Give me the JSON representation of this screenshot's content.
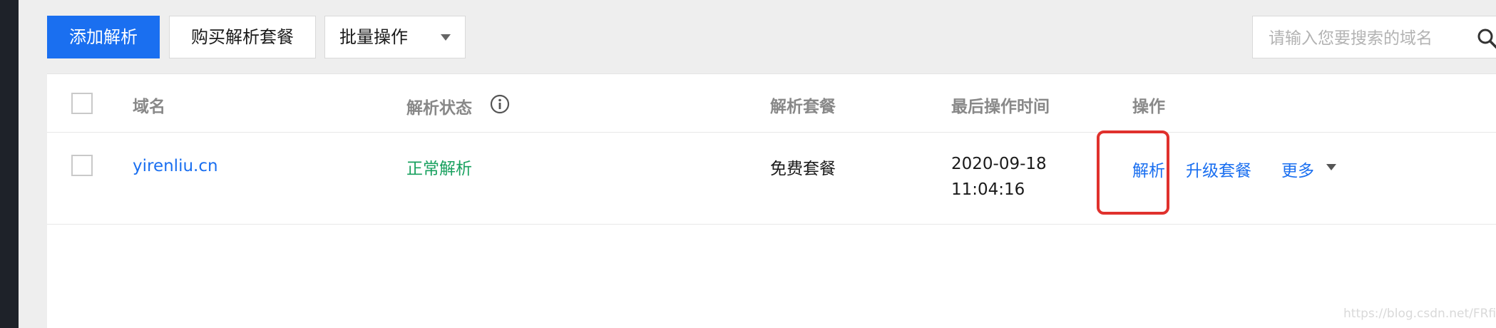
{
  "toolbar": {
    "add_button": "添加解析",
    "buy_button": "购买解析套餐",
    "batch_select": "批量操作",
    "search_placeholder": "请输入您要搜索的域名"
  },
  "table": {
    "headers": {
      "domain": "域名",
      "status": "解析状态",
      "package": "解析套餐",
      "last_op_time": "最后操作时间",
      "actions": "操作"
    },
    "rows": [
      {
        "domain": "yirenliu.cn",
        "status": "正常解析",
        "package": "免费套餐",
        "date": "2020-09-18",
        "time": "11:04:16",
        "action_resolve": "解析",
        "action_upgrade": "升级套餐",
        "action_more": "更多"
      }
    ]
  },
  "watermark": "https://blog.csdn.net/FRfiddle",
  "colors": {
    "primary": "#1a6ff0",
    "status_ok": "#19a15f",
    "highlight": "#e0312d"
  }
}
